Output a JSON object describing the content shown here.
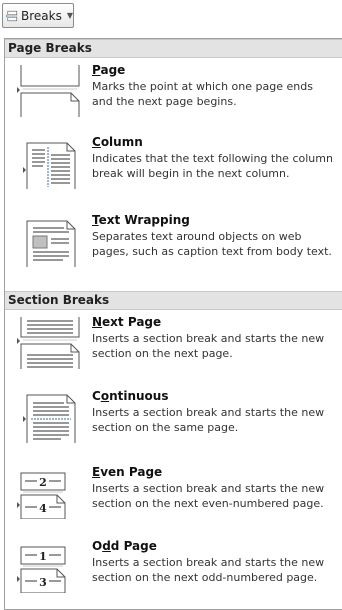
{
  "toolbar": {
    "breaks_label": "Breaks",
    "breaks_icon": "page-break-icon",
    "caret_icon": "chevron-down-icon"
  },
  "menu": {
    "sections": [
      {
        "header": "Page Breaks",
        "items": [
          {
            "access_key": "P",
            "title_rest": "age",
            "desc_line1": "Marks the point at which one page ends",
            "desc_line2": "and the next page begins.",
            "icon": "page-break-icon"
          },
          {
            "access_key": "C",
            "title_rest": "olumn",
            "desc_line1": "Indicates that the text following the column",
            "desc_line2": "break will begin in the next column.",
            "icon": "column-break-icon"
          },
          {
            "access_key": "T",
            "title_rest": "ext Wrapping",
            "desc_line1": "Separates text around objects on web",
            "desc_line2": "pages, such as caption text from body text.",
            "icon": "text-wrapping-icon"
          }
        ]
      },
      {
        "header": "Section Breaks",
        "items": [
          {
            "access_key": "N",
            "title_rest": "ext Page",
            "desc_line1": "Inserts a section break and starts the new",
            "desc_line2": "section on the next page.",
            "icon": "next-page-section-icon"
          },
          {
            "title_pre": "C",
            "access_key": "o",
            "title_rest": "ntinuous",
            "desc_line1": "Inserts a section break and starts the new",
            "desc_line2": "section on the same page.",
            "icon": "continuous-section-icon"
          },
          {
            "access_key": "E",
            "title_rest": "ven Page",
            "desc_line1": "Inserts a section break and starts the new",
            "desc_line2": "section on the next even-numbered page.",
            "icon": "even-page-section-icon",
            "icon_numbers": [
              "2",
              "4"
            ]
          },
          {
            "title_pre": "O",
            "access_key": "d",
            "title_rest": "d Page",
            "desc_line1": "Inserts a section break and starts the new",
            "desc_line2": "section on the next odd-numbered page.",
            "icon": "odd-page-section-icon",
            "icon_numbers": [
              "1",
              "3"
            ]
          }
        ]
      }
    ]
  }
}
